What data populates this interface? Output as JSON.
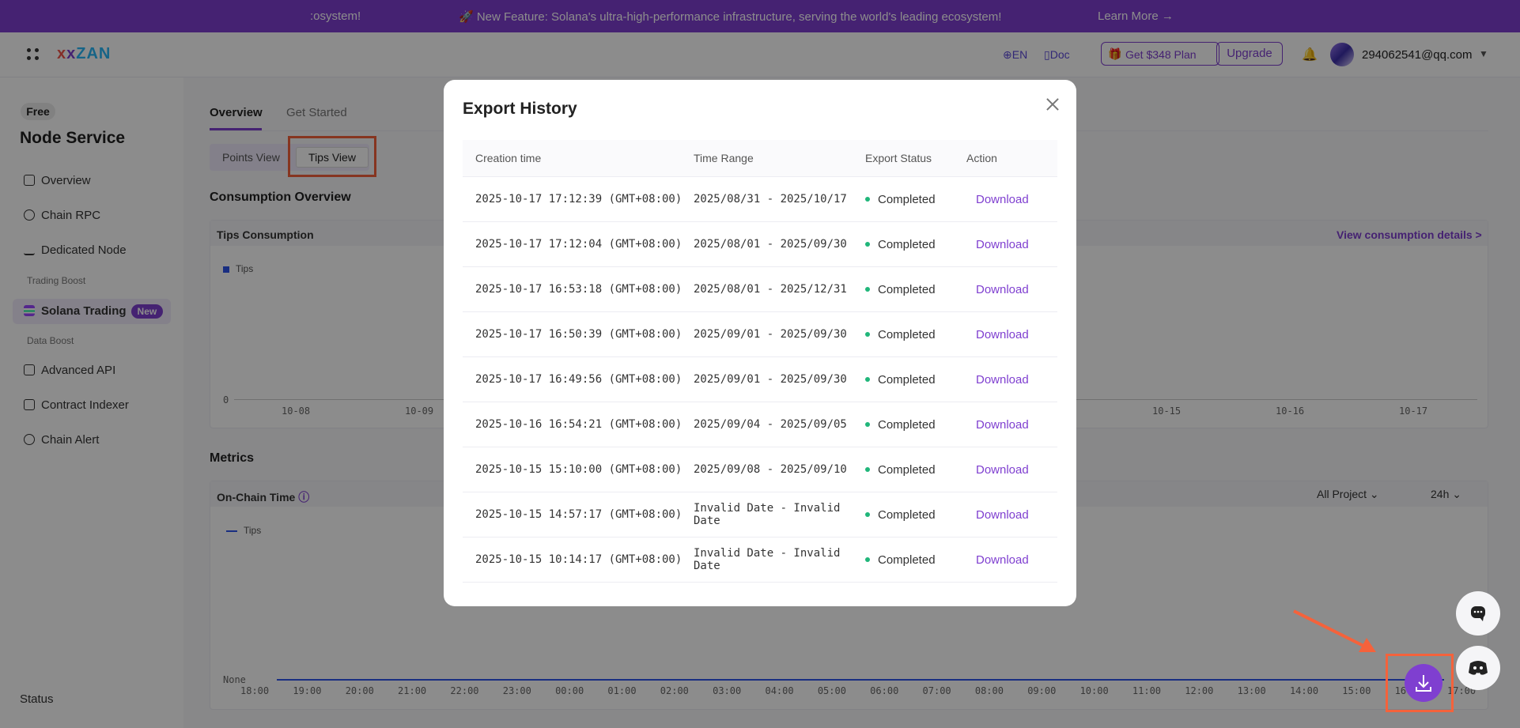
{
  "banner": {
    "left_fragment": ":osystem!",
    "feature_text": "🚀 New Feature: Solana's ultra-high-performance infrastructure, serving the world's leading ecosystem!",
    "learn_more": "Learn More"
  },
  "header": {
    "logo": "ZAN",
    "lang": "EN",
    "doc": "Doc",
    "plan_button": "Get $348 Plan",
    "upgrade_button": "Upgrade",
    "email": "294062541@qq.com"
  },
  "sidebar": {
    "badge": "Free",
    "title": "Node Service",
    "items": [
      {
        "label": "Overview"
      },
      {
        "label": "Chain RPC"
      },
      {
        "label": "Dedicated Node"
      },
      {
        "label": "Solana Trading"
      },
      {
        "label": "Advanced API"
      },
      {
        "label": "Contract Indexer"
      },
      {
        "label": "Chain Alert"
      }
    ],
    "group_trading": "Trading Boost",
    "group_data": "Data Boost",
    "new_badge": "New",
    "status": "Status"
  },
  "main": {
    "tabs": [
      "Overview",
      "Get Started"
    ],
    "view_toggle": [
      "Points View",
      "Tips View"
    ],
    "consumption_title": "Consumption Overview",
    "tips_panel_title": "Tips Consumption",
    "view_details": "View consumption details >",
    "legend_tips": "Tips",
    "y_zero": "0",
    "dates_left": [
      "10-08",
      "10-09"
    ],
    "dates_right": [
      "10-15",
      "10-16",
      "10-17"
    ],
    "metrics_title": "Metrics",
    "onchain_title": "On-Chain Time",
    "dropdown_project": "All Project",
    "dropdown_range": "24h",
    "legend_tips2": "Tips",
    "y_none": "None",
    "hours": [
      "18:00",
      "19:00",
      "20:00",
      "21:00",
      "22:00",
      "23:00",
      "00:00",
      "01:00",
      "02:00",
      "03:00",
      "04:00",
      "05:00",
      "06:00",
      "07:00",
      "08:00",
      "09:00",
      "10:00",
      "11:00",
      "12:00",
      "13:00",
      "14:00",
      "15:00",
      "16:00",
      "17:00"
    ]
  },
  "modal": {
    "title": "Export History",
    "columns": [
      "Creation time",
      "Time Range",
      "Export Status",
      "Action"
    ],
    "rows": [
      {
        "created": "2025-10-17 17:12:39 (GMT+08:00)",
        "range": "2025/08/31 - 2025/10/17",
        "status": "Completed",
        "action": "Download"
      },
      {
        "created": "2025-10-17 17:12:04 (GMT+08:00)",
        "range": "2025/08/01 - 2025/09/30",
        "status": "Completed",
        "action": "Download"
      },
      {
        "created": "2025-10-17 16:53:18 (GMT+08:00)",
        "range": "2025/08/01 - 2025/12/31",
        "status": "Completed",
        "action": "Download"
      },
      {
        "created": "2025-10-17 16:50:39 (GMT+08:00)",
        "range": "2025/09/01 - 2025/09/30",
        "status": "Completed",
        "action": "Download"
      },
      {
        "created": "2025-10-17 16:49:56 (GMT+08:00)",
        "range": "2025/09/01 - 2025/09/30",
        "status": "Completed",
        "action": "Download"
      },
      {
        "created": "2025-10-16 16:54:21 (GMT+08:00)",
        "range": "2025/09/04 - 2025/09/05",
        "status": "Completed",
        "action": "Download"
      },
      {
        "created": "2025-10-15 15:10:00 (GMT+08:00)",
        "range": "2025/09/08 - 2025/09/10",
        "status": "Completed",
        "action": "Download"
      },
      {
        "created": "2025-10-15 14:57:17 (GMT+08:00)",
        "range": "Invalid Date - Invalid Date",
        "status": "Completed",
        "action": "Download"
      },
      {
        "created": "2025-10-15 10:14:17 (GMT+08:00)",
        "range": "Invalid Date - Invalid Date",
        "status": "Completed",
        "action": "Download"
      }
    ]
  },
  "colors": {
    "brand": "#7f3fd0",
    "status_completed": "#20b67a",
    "highlight": "#f5623b"
  }
}
